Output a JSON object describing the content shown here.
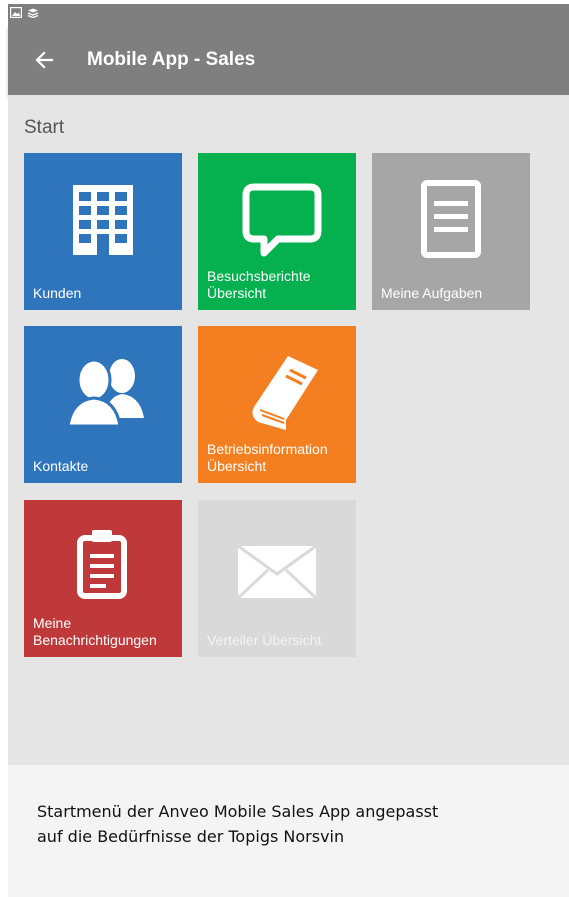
{
  "statusbar": {
    "icons": [
      "image-icon",
      "layers-icon"
    ]
  },
  "appbar": {
    "back_icon": "arrow-left-icon",
    "title": "Mobile App - Sales"
  },
  "section": {
    "title": "Start"
  },
  "tiles": [
    {
      "label": [
        "Kunden"
      ],
      "color": "#2f75bb",
      "icon": "building-icon",
      "enabled": true
    },
    {
      "label": [
        "Besuchsberichte",
        "Übersicht"
      ],
      "color": "#05b04f",
      "icon": "speech-bubble-icon",
      "enabled": true
    },
    {
      "label": [
        "Meine Aufgaben"
      ],
      "color": "#a6a6a6",
      "icon": "document-lines-icon",
      "enabled": true
    },
    {
      "label": [
        "Kontakte"
      ],
      "color": "#2f75bb",
      "icon": "people-icon",
      "enabled": true
    },
    {
      "label": [
        "Betriebsinformation",
        "Übersicht"
      ],
      "color": "#f47f20",
      "icon": "book-icon",
      "enabled": true
    },
    {
      "label": [
        "Meine",
        "Benachrichtigungen"
      ],
      "color": "#c0393a",
      "icon": "clipboard-icon",
      "enabled": true
    },
    {
      "label": [
        "Verteiler Übersicht"
      ],
      "color": "#d9d9d9",
      "icon": "envelope-icon",
      "enabled": false
    }
  ],
  "caption": {
    "line1": "Startmenü der Anveo Mobile Sales App angepasst",
    "line2": "auf die Bedürfnisse der Topigs Norsvin"
  }
}
